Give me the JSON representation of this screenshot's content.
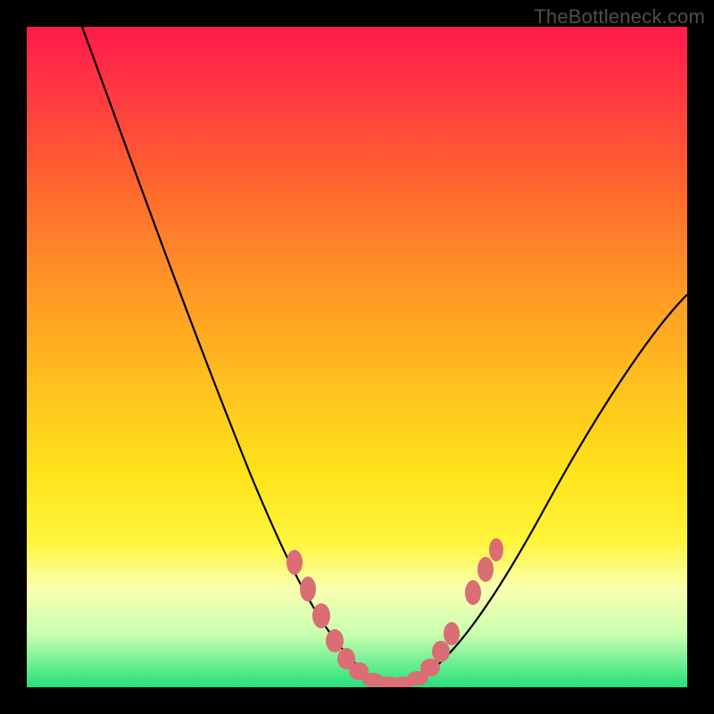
{
  "watermark": "TheBottleneck.com",
  "colors": {
    "frame": "#000000",
    "curve": "#000000",
    "dot": "#db6d74",
    "gradient_top": "#ff1a4b",
    "gradient_bottom": "#25e07a"
  },
  "chart_data": {
    "type": "line",
    "title": "",
    "xlabel": "",
    "ylabel": "",
    "xlim": [
      0,
      100
    ],
    "ylim": [
      0,
      100
    ],
    "grid": false,
    "legend": false,
    "annotations": [
      "TheBottleneck.com"
    ],
    "series": [
      {
        "name": "bottleneck-curve",
        "x": [
          10,
          15,
          20,
          25,
          30,
          35,
          40,
          45,
          48,
          50,
          52,
          55,
          58,
          60,
          62,
          65,
          70,
          75,
          80,
          85,
          90,
          95,
          100
        ],
        "y": [
          100,
          90,
          78,
          65,
          52,
          40,
          28,
          16,
          9,
          5,
          2,
          0,
          0,
          1,
          3,
          6,
          13,
          20,
          27,
          34,
          41,
          47,
          52
        ]
      }
    ],
    "highlight_points": {
      "name": "highlighted-range",
      "x": [
        40,
        42,
        44,
        46,
        48,
        50,
        52,
        54,
        56,
        58,
        60,
        62,
        63,
        65,
        66
      ],
      "y": [
        28,
        24,
        19,
        14,
        9,
        5,
        2,
        0,
        0,
        0,
        1,
        3,
        4,
        6,
        8
      ]
    }
  }
}
